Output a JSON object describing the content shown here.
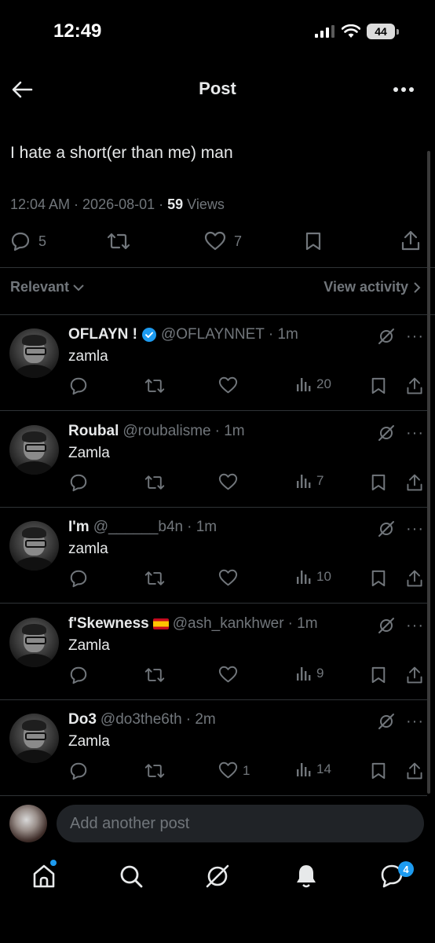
{
  "status_bar": {
    "time": "12:49",
    "battery": "44"
  },
  "header": {
    "title": "Post"
  },
  "post": {
    "text": "I hate a short(er than me) man",
    "timestamp": "12:04 AM · 2026-08-01 · ",
    "views_count": "59",
    "views_label": " Views",
    "replies": "5",
    "likes": "7"
  },
  "sort": {
    "label": "Relevant",
    "view_activity": "View activity"
  },
  "replies": [
    {
      "name": "OFLAYN !",
      "handle": "@OFLAYNNET",
      "time": "· 1m",
      "text": "zamla",
      "likes": "",
      "views": "20",
      "verified": true,
      "flag": false
    },
    {
      "name": "Roubal",
      "handle": "@roubalisme",
      "time": "· 1m",
      "text": "Zamla",
      "likes": "",
      "views": "7",
      "verified": false,
      "flag": false
    },
    {
      "name": "I'm",
      "handle": "@______b4n",
      "time": "· 1m",
      "text": "zamla",
      "likes": "",
      "views": "10",
      "verified": false,
      "flag": false
    },
    {
      "name": "f'Skewness",
      "handle": "@ash_kankhwer",
      "time": "· 1m",
      "text": "Zamla",
      "likes": "",
      "views": "9",
      "verified": false,
      "flag": true
    },
    {
      "name": "Do3",
      "handle": "@do3the6th",
      "time": "· 2m",
      "text": "Zamla",
      "likes": "1",
      "views": "14",
      "verified": false,
      "flag": false
    }
  ],
  "compose": {
    "placeholder": "Add another post"
  },
  "tab_bar": {
    "messages_badge": "4"
  },
  "colors": {
    "background": "#000000",
    "accent": "#1d9bf0",
    "muted": "#71767b",
    "text": "#e7e9ea"
  }
}
